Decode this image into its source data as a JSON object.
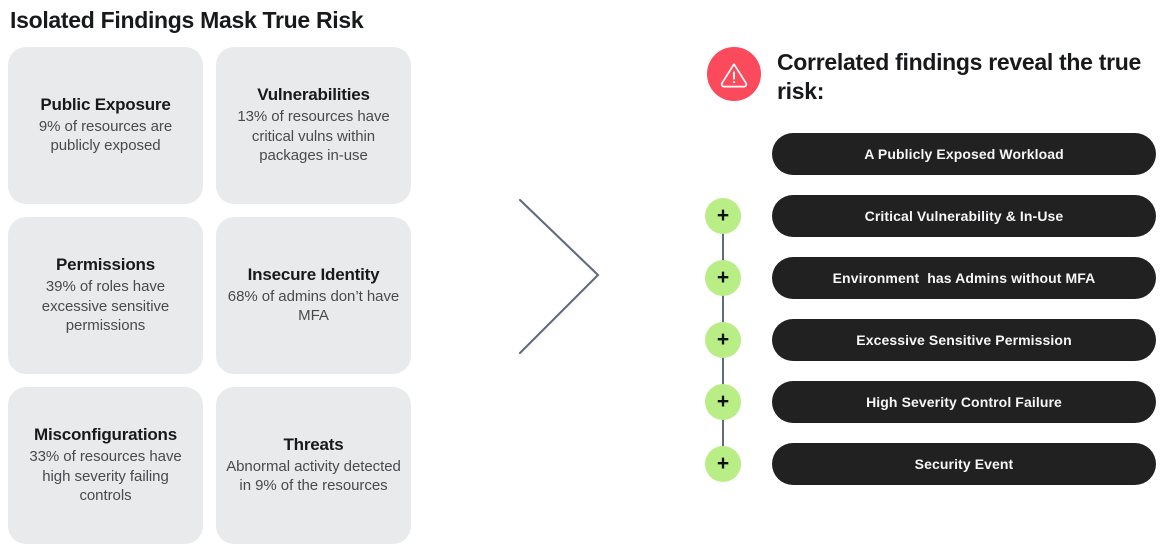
{
  "left": {
    "title": "Isolated Findings Mask True Risk",
    "cards": [
      {
        "title": "Public Exposure",
        "desc": "9% of resources are publicly exposed"
      },
      {
        "title": "Vulnerabilities",
        "desc": "13% of resources have critical vulns within packages in-use"
      },
      {
        "title": "Permissions",
        "desc": "39% of roles have excessive sensitive permissions"
      },
      {
        "title": "Insecure Identity",
        "desc": "68% of admins don’t have MFA"
      },
      {
        "title": "Misconfigurations",
        "desc": "33% of resources have high severity failing controls"
      },
      {
        "title": "Threats",
        "desc": "Abnormal activity detected in 9% of the resources"
      }
    ]
  },
  "connector": {
    "icon": "chevron-right-icon",
    "color": "#5f6b80"
  },
  "right": {
    "warning_icon": "warning-triangle-icon",
    "heading": "Correlated findings reveal the true risk:",
    "plus_label": "+",
    "chain": [
      {
        "label": "A Publicly Exposed Workload",
        "has_plus": false
      },
      {
        "label": "Critical Vulnerability & In-Use",
        "has_plus": true
      },
      {
        "label": "Environment  has Admins without MFA",
        "has_plus": true
      },
      {
        "label": "Excessive Sensitive Permission",
        "has_plus": true
      },
      {
        "label": "High Severity Control Failure",
        "has_plus": true
      },
      {
        "label": "Security Event",
        "has_plus": true
      }
    ]
  },
  "colors": {
    "card_bg": "#e9eaec",
    "pill_bg": "#212121",
    "plus_bg": "#b8ee85",
    "warning_bg": "#fa4a5c",
    "line": "#5f6b80",
    "text_dark": "#18191b",
    "text_muted": "#474a4f"
  }
}
